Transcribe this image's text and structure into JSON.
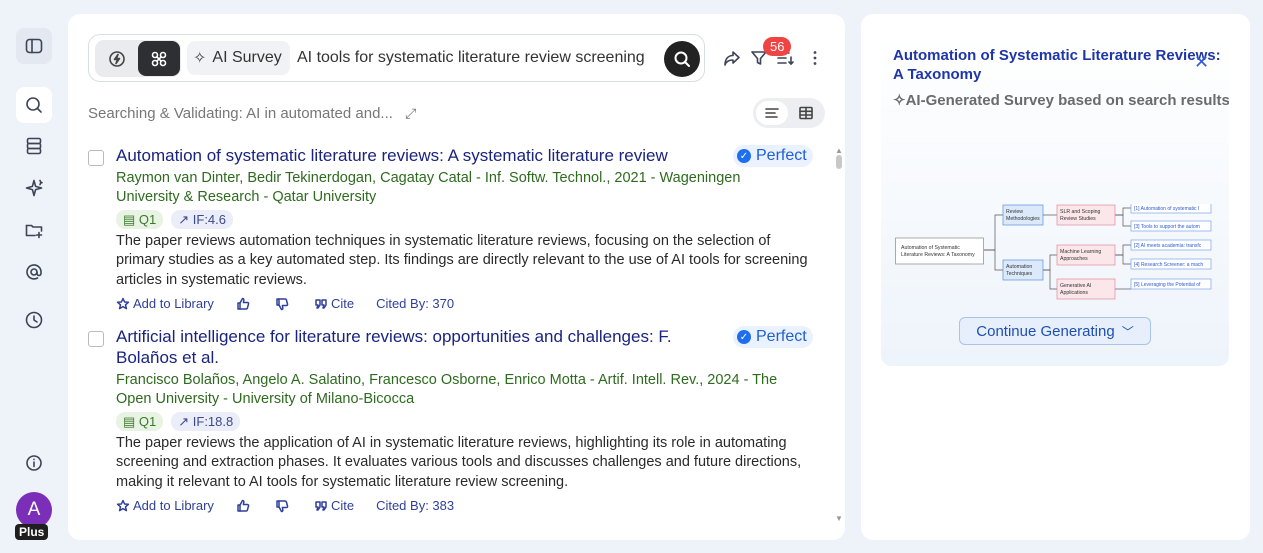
{
  "rail": {
    "icons": [
      "sidebar-toggle-icon",
      "search-icon",
      "library-icon",
      "sparkle-icon",
      "folder-add-icon",
      "mention-icon",
      "history-icon",
      "info-icon"
    ],
    "avatar_letter": "A",
    "plan_badge": "Plus"
  },
  "search": {
    "mode_chip": "AI Survey",
    "query": "AI tools for systematic literature review screening"
  },
  "toolbar": {
    "filter_count": "56"
  },
  "status": {
    "text": "Searching & Validating: AI in automated and..."
  },
  "results": [
    {
      "title": "Automation of systematic literature reviews: A systematic literature review",
      "badge": "Perfect",
      "authors": "Raymon van Dinter, Bedir Tekinerdogan, Cagatay Catal - Inf. Softw. Technol., 2021 - Wageningen University & Research - Qatar University",
      "quartile": "Q1",
      "impact": "IF:4.6",
      "abstract": "The paper reviews automation techniques in systematic literature reviews, focusing on the selection of primary studies as a key automated step. Its findings are directly relevant to the use of AI tools for screening articles in systematic reviews.",
      "add_label": "Add to Library",
      "cite_label": "Cite",
      "cited_by": "Cited By: 370"
    },
    {
      "title": "Artificial intelligence for literature reviews: opportunities and challenges: F. Bolaños et al.",
      "badge": "Perfect",
      "authors": "Francisco Bolaños, Angelo A. Salatino, Francesco Osborne, Enrico Motta - Artif. Intell. Rev., 2024 - The Open University - University of Milano-Bicocca",
      "quartile": "Q1",
      "impact": "IF:18.8",
      "abstract": "The paper reviews the application of AI in systematic literature reviews, highlighting its role in automating screening and extraction phases. It evaluates various tools and discusses challenges and future directions, making it relevant to AI tools for systematic literature review screening.",
      "add_label": "Add to Library",
      "cite_label": "Cite",
      "cited_by": "Cited By: 383"
    }
  ],
  "survey": {
    "title": "Automation of Systematic Literature Reviews: A Taxonomy",
    "subtitle": "AI-Generated Survey based on search results",
    "continue_label": "Continue Generating",
    "mindmap": {
      "root": [
        "Automation of Systematic",
        "Literature Reviews: A Taxonomy"
      ],
      "branch1": [
        "Review",
        "Methodologies"
      ],
      "branch2": [
        "Automation",
        "Techniques"
      ],
      "leaf1": [
        "SLR and Scoping",
        "Review Studies"
      ],
      "leaf2": [
        "Machine Learning",
        "Approaches"
      ],
      "leaf3": [
        "Generative AI",
        "Applications"
      ],
      "ref1": "[1] Automation of systematic l",
      "ref2": "[3] Tools to support the autom",
      "ref3": "[2] AI meets academia: transfc",
      "ref4": "[4] Research Screener: a mach",
      "ref5": "[5] Leveraging the Potential of"
    }
  },
  "colors": {
    "title_blue": "#1a237e",
    "author_green": "#2e6b1f",
    "badge_red": "#ef4444",
    "perfect_blue": "#1e5ed6"
  }
}
